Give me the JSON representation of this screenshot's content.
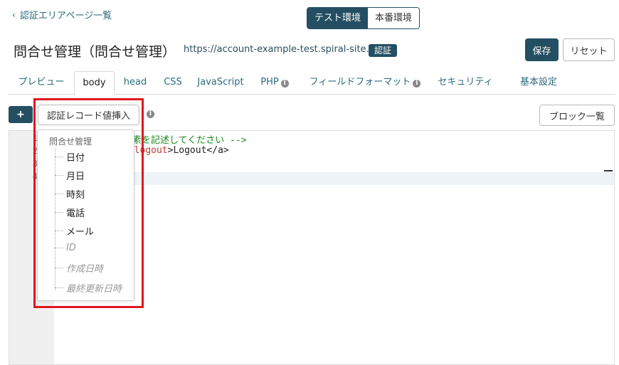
{
  "nav": {
    "back_label": "認証エリアページ一覧"
  },
  "environment": {
    "test_label": "テスト環境",
    "prod_label": "本番環境",
    "selected": "テスト環境"
  },
  "header": {
    "title": "問合せ管理（問合せ管理）",
    "url": "https://account-example-test.spiral-site.com",
    "badge": "認証",
    "save_label": "保存",
    "reset_label": "リセット"
  },
  "tabs": [
    {
      "label": "プレビュー",
      "active": false,
      "info": false
    },
    {
      "label": "body",
      "active": true,
      "info": false
    },
    {
      "label": "head",
      "active": false,
      "info": false
    },
    {
      "label": "CSS",
      "active": false,
      "info": false
    },
    {
      "label": "JavaScript",
      "active": false,
      "info": false
    },
    {
      "label": "PHP",
      "active": false,
      "info": true
    },
    {
      "label": "フィールドフォーマット",
      "active": false,
      "info": true
    },
    {
      "label": "セキュリティ",
      "active": false,
      "info": false
    },
    {
      "label": "基本設定",
      "active": false,
      "info": false
    }
  ],
  "toolbar": {
    "plus_label": "+",
    "insert_label": "認証レコード値挿入",
    "info_glyph": "i",
    "block_list_label": "ブロック一覧"
  },
  "editor": {
    "line_numbers": [
      "1",
      "2",
      "3",
      "4"
    ],
    "line1_visible": "要素を記述してください -->",
    "line2_attr": "a-logout",
    "line2_rest": ">Logout</a>"
  },
  "dropdown": {
    "root_label": "問合せ管理",
    "items": [
      {
        "label": "日付",
        "disabled": false
      },
      {
        "label": "月日",
        "disabled": false
      },
      {
        "label": "時刻",
        "disabled": false
      },
      {
        "label": "電話",
        "disabled": false
      },
      {
        "label": "メール",
        "disabled": false
      },
      {
        "label": "ID",
        "disabled": true
      },
      {
        "label": "作成日時",
        "disabled": true
      },
      {
        "label": "最終更新日時",
        "disabled": true
      }
    ]
  },
  "colors": {
    "primary": "#244f62",
    "link": "#2b6a7e",
    "highlight": "#e0161e",
    "comment": "#1a8a1a",
    "attribute": "#c0392b"
  }
}
